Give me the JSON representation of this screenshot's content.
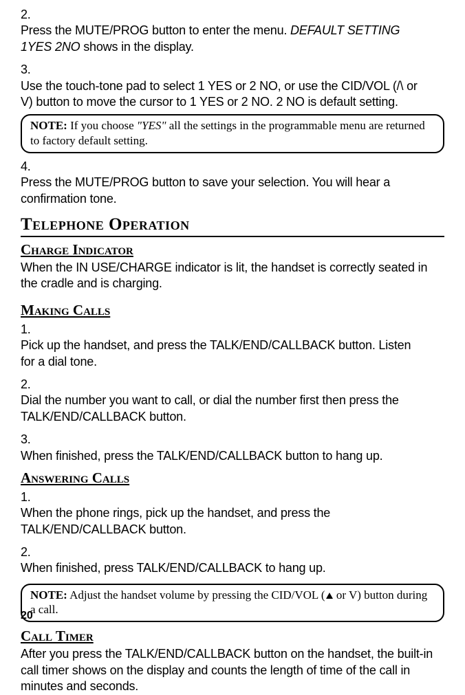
{
  "step2": {
    "num": "2.",
    "text_before": "Press the MUTE/PROG button to enter the menu. ",
    "italic": "DEFAULT SETTING 1YES 2NO",
    "text_after": " shows in the display."
  },
  "step3": {
    "num": "3.",
    "text": "Use the touch-tone pad to select 1 YES or 2 NO, or use the CID/VOL (/\\ or V) button to move the cursor to 1 YES or 2 NO. 2 NO is default setting."
  },
  "note1": {
    "label": "NOTE:",
    "before_quote": " If you choose ",
    "quote": "\"YES\"",
    "after_quote": " all the settings in the programmable menu are returned to factory default setting."
  },
  "step4": {
    "num": "4.",
    "text": "Press the MUTE/PROG button to save your selection. You will hear a confirmation tone."
  },
  "sec_title": "Telephone Operation",
  "charge": {
    "title": "Charge Indicator",
    "para": "When the IN USE/CHARGE indicator is lit, the handset is correctly seated in the cradle and is charging."
  },
  "making": {
    "title": "Making Calls",
    "i1": {
      "num": "1.",
      "text": "Pick up the handset, and press the TALK/END/CALLBACK button. Listen for a dial tone."
    },
    "i2": {
      "num": "2.",
      "text": "Dial the number you want to call, or dial the number first then press the TALK/END/CALLBACK button."
    },
    "i3": {
      "num": "3.",
      "text": "When finished, press the TALK/END/CALLBACK button to hang up."
    }
  },
  "answering": {
    "title": "Answering Calls",
    "i1": {
      "num": "1.",
      "text": "When the phone rings, pick up the handset, and press the TALK/END/CALLBACK button."
    },
    "i2": {
      "num": "2.",
      "text": "When finished, press TALK/END/CALLBACK to hang up."
    }
  },
  "note2": {
    "label": "NOTE:",
    "before": " Adjust the handset volume by pressing the CID/VOL (",
    "after": " or V) button during a call."
  },
  "timer": {
    "title": "Call Timer",
    "para": "After you press the TALK/END/CALLBACK button on the handset, the built-in call timer shows on the display and counts the length of time of the call in minutes and seconds."
  },
  "page_number": "20"
}
